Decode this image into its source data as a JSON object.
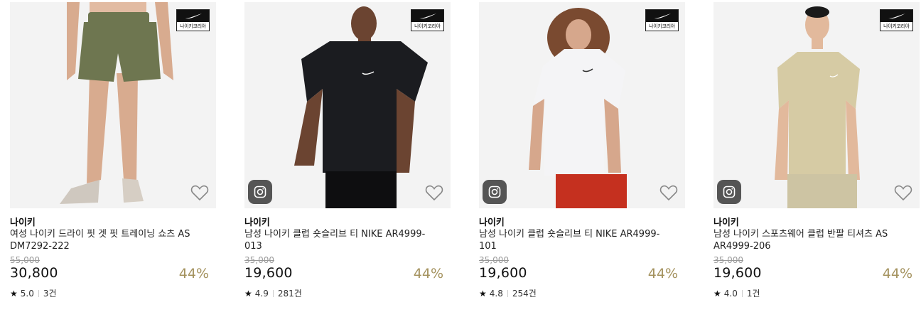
{
  "products": [
    {
      "brand": "나이키",
      "name": "여성 나이키 드라이 핏 겟 핏 트레이닝 쇼츠 AS DM7292-222",
      "original_price": "55,000",
      "price": "30,800",
      "discount": "44%",
      "rating": "5.0",
      "reviews": "3건",
      "badge_text": "나이키코리아",
      "garment_color": "#6e7650",
      "skin_color": "#d8ab8f",
      "has_instagram": false
    },
    {
      "brand": "나이키",
      "name": "남성 나이키 클럽 숏슬리브 티 NIKE AR4999-013",
      "original_price": "35,000",
      "price": "19,600",
      "discount": "44%",
      "rating": "4.9",
      "reviews": "281건",
      "badge_text": "나이키코리아",
      "garment_color": "#1b1c20",
      "skin_color": "#6b4431",
      "has_instagram": true
    },
    {
      "brand": "나이키",
      "name": "남성 나이키 클럽 숏슬리브 티 NIKE AR4999-101",
      "original_price": "35,000",
      "price": "19,600",
      "discount": "44%",
      "rating": "4.8",
      "reviews": "254건",
      "badge_text": "나이키코리아",
      "garment_color": "#f4f4f6",
      "skin_color": "#d6a78c",
      "has_instagram": true
    },
    {
      "brand": "나이키",
      "name": "남성 나이키 스포츠웨어 클럽 반팔 티셔츠 AS AR4999-206",
      "original_price": "35,000",
      "price": "19,600",
      "discount": "44%",
      "rating": "4.0",
      "reviews": "1건",
      "badge_text": "나이키코리아",
      "garment_color": "#d6cba4",
      "skin_color": "#e2b99c",
      "has_instagram": true
    }
  ],
  "icons": {
    "logo": "nike-swoosh-icon",
    "instagram": "instagram-icon",
    "wishlist": "heart-outline-icon",
    "rating": "star-icon"
  }
}
